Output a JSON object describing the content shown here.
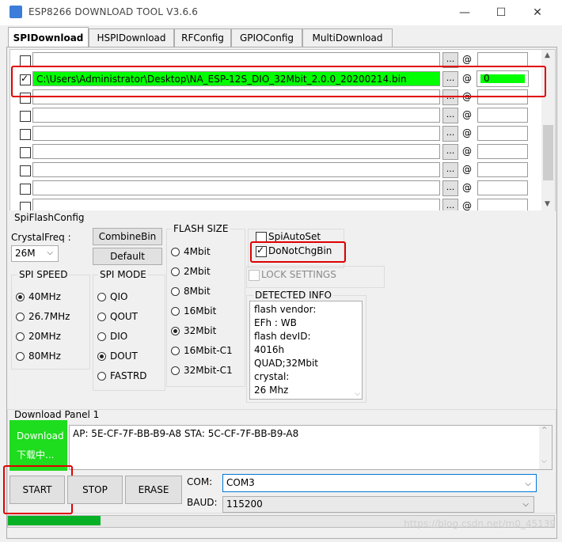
{
  "window": {
    "title": "ESP8266 DOWNLOAD TOOL V3.6.6",
    "minimize": "—",
    "maximize": "☐",
    "close": "✕"
  },
  "tabs": [
    {
      "label": "SPIDownload",
      "active": true
    },
    {
      "label": "HSPIDownload",
      "active": false
    },
    {
      "label": "RFConfig",
      "active": false
    },
    {
      "label": "GPIOConfig",
      "active": false
    },
    {
      "label": "MultiDownload",
      "active": false
    }
  ],
  "file_rows": [
    {
      "checked": false,
      "path": "",
      "offset": "",
      "highlighted": false
    },
    {
      "checked": true,
      "path": "C:\\Users\\Administrator\\Desktop\\NA_ESP-12S_DIO_32Mbit_2.0.0_20200214.bin",
      "offset": "0",
      "highlighted": true
    },
    {
      "checked": false,
      "path": "",
      "offset": "",
      "highlighted": false
    },
    {
      "checked": false,
      "path": "",
      "offset": "",
      "highlighted": false
    },
    {
      "checked": false,
      "path": "",
      "offset": "",
      "highlighted": false
    },
    {
      "checked": false,
      "path": "",
      "offset": "",
      "highlighted": false
    },
    {
      "checked": false,
      "path": "",
      "offset": "",
      "highlighted": false
    },
    {
      "checked": false,
      "path": "",
      "offset": "",
      "highlighted": false
    },
    {
      "checked": false,
      "path": "",
      "offset": "",
      "highlighted": false
    }
  ],
  "browse_label": "...",
  "at_label": "@",
  "spi_flash_config": {
    "title": "SpiFlashConfig",
    "crystal_label": "CrystalFreq :",
    "crystal_value": "26M",
    "combine_bin": "CombineBin",
    "default": "Default"
  },
  "spi_speed": {
    "title": "SPI SPEED",
    "options": [
      "40MHz",
      "26.7MHz",
      "20MHz",
      "80MHz"
    ],
    "selected": 0
  },
  "spi_mode": {
    "title": "SPI MODE",
    "options": [
      "QIO",
      "QOUT",
      "DIO",
      "DOUT",
      "FASTRD"
    ],
    "selected": 3
  },
  "flash_size": {
    "title": "FLASH SIZE",
    "options": [
      "4Mbit",
      "2Mbit",
      "8Mbit",
      "16Mbit",
      "32Mbit",
      "16Mbit-C1",
      "32Mbit-C1"
    ],
    "selected": 4
  },
  "spi_auto_set": {
    "label": "SpiAutoSet",
    "checked": false
  },
  "do_not_chg_bin": {
    "label": "DoNotChgBin",
    "checked": true
  },
  "lock_settings": {
    "label": "LOCK SETTINGS",
    "checked": false
  },
  "detected_info": {
    "title": "DETECTED INFO",
    "lines": [
      "flash vendor:",
      "EFh : WB",
      "flash devID:",
      "4016h",
      "QUAD;32Mbit",
      "crystal:",
      "26 Mhz"
    ]
  },
  "download_panel": {
    "title": "Download Panel 1",
    "status_line1": "Download",
    "status_line2": "下载中...",
    "log_text": "AP:  5E-CF-7F-BB-B9-A8  STA:  5C-CF-7F-BB-B9-A8",
    "start": "START",
    "stop": "STOP",
    "erase": "ERASE",
    "com_label": "COM:",
    "com_value": "COM3",
    "baud_label": "BAUD:",
    "baud_value": "115200",
    "progress": 0.17
  },
  "watermark": "https://blog.csdn.net/m0_45139",
  "colors": {
    "highlight_green": "#00ff00",
    "annotation_red": "#e00000",
    "progress_green": "#06b025"
  }
}
